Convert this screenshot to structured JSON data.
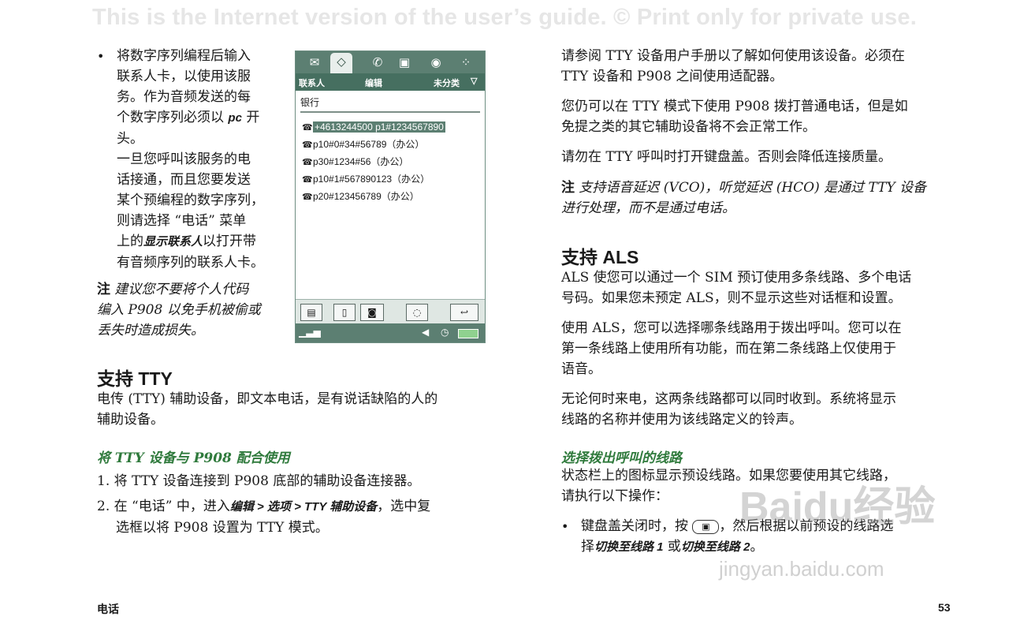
{
  "banner": "This is the Internet version of the user’s guide. © Print only for private use.",
  "left": {
    "bullet_lines": [
      "将数字序列编程后输入",
      "联系人卡，以使用该服",
      "务。作为音频发送的每"
    ],
    "bullet_line4_a": "个数字序列必须以 ",
    "bullet_line4_pc": "pc",
    "bullet_line4_b": " 开",
    "bullet_line5": "头。",
    "para2_lines": [
      "一旦您呼叫该服务的电",
      "话接通，而且您要发送",
      "某个预编程的数字序列，",
      "则请选择 “电话” 菜单"
    ],
    "para2_line5_a": "上的",
    "para2_line5_em": "显示联系人",
    "para2_line5_b": "以打开带",
    "para2_line6": "有音频序列的联系人卡。",
    "note_label": "注",
    "note_lines": [
      "建议您不要将个人代码",
      "编入 P908 以免手机被偷或",
      "丢失时造成损失。"
    ],
    "h_tty": "支持 TTY",
    "tty_lines": [
      "电传 (TTY) 辅助设备，即文本电话，是有说话缺陷的人的",
      "辅助设备。"
    ],
    "h_tty_use": "将 TTY 设备与 P908 配合使用",
    "step1": "1. 将 TTY 设备连接到 P908 底部的辅助设备连接器。",
    "step2_a": "2. 在 “电话” 中，进入",
    "step2_em": "编辑 > 选项 > TTY 辅助设备",
    "step2_b": "，选中复",
    "step2_line2": "选框以将 P908 设置为 TTY 模式。",
    "footer_left": "电话"
  },
  "phone": {
    "bar_left": "联系人",
    "bar_mid": "编辑",
    "bar_right": "未分类",
    "search_value": "银行",
    "items": [
      "+4613244500 p1#1234567890",
      "p10#0#34#56789（办公）",
      "p30#1234#56（办公）",
      "p10#1#567890123（办公）",
      "p20#123456789（办公）"
    ],
    "icons": [
      "envelope-icon",
      "contacts-tag-icon",
      "phone-handset-icon",
      "calendar-icon",
      "search-globe-icon",
      "apps-grid-icon"
    ]
  },
  "right": {
    "p1_lines": [
      "请参阅 TTY 设备用户手册以了解如何使用该设备。必须在",
      "TTY 设备和 P908 之间使用适配器。"
    ],
    "p2_lines": [
      "您仍可以在 TTY 模式下使用 P908 拨打普通电话，但是如",
      "免提之类的其它辅助设备将不会正常工作。"
    ],
    "p3": "请勿在 TTY 呼叫时打开键盘盖。否则会降低连接质量。",
    "note_label": "注",
    "note_lines": [
      "支持语音延迟 (VCO)，听觉延迟 (HCO) 是通过 TTY 设备",
      "进行处理，而不是通过电话。"
    ],
    "h_als": "支持 ALS",
    "als1_lines": [
      "ALS 使您可以通过一个 SIM 预订使用多条线路、多个电话",
      "号码。如果您未预定 ALS，则不显示这些对话框和设置。"
    ],
    "als2_lines": [
      "使用 ALS，您可以选择哪条线路用于拨出呼叫。您可以在",
      "第一条线路上使用所有功能，而在第二条线路上仅使用于",
      "语音。"
    ],
    "als3_lines": [
      "无论何时来电，这两条线路都可以同时收到。系统将显示",
      "线路的名称并使用为该线路定义的铃声。"
    ],
    "h_select": "选择拨出呼叫的线路",
    "sel_lines": [
      "状态栏上的图标显示预设线路。如果您要使用其它线路，",
      "请执行以下操作："
    ],
    "bullet_a": "键盘盖关闭时，按 ",
    "bullet_b": "，然后根据以前预设的线路选",
    "bullet_line2_a": "择",
    "bullet_em1": "切换至线路 1",
    "bullet_or": " 或",
    "bullet_em2": "切换至线路 2",
    "bullet_end": "。",
    "footer_page": "53",
    "watermark": "Baidu经验",
    "watermark_url": "jingyan.baidu.com"
  }
}
